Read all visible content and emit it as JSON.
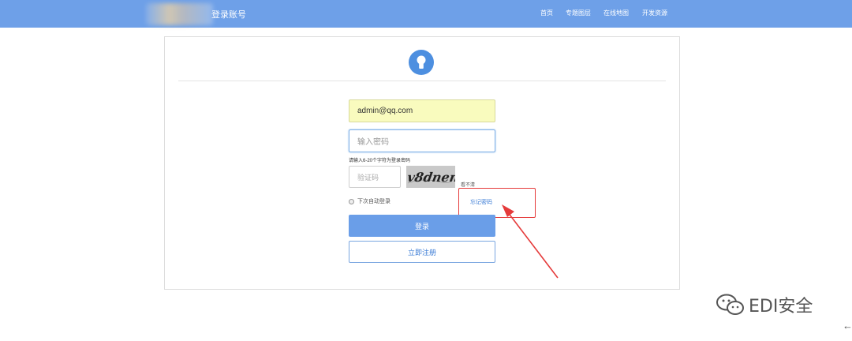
{
  "header": {
    "site_title": "登录账号",
    "nav": [
      {
        "label": "首页"
      },
      {
        "label": "专题图层"
      },
      {
        "label": "在线地图"
      },
      {
        "label": "开发资源"
      }
    ],
    "color": "#6ea0e8"
  },
  "login": {
    "email_value": "admin@qq.com",
    "password_placeholder": "输入密码",
    "password_hint": "请输入6-20个字符为登录密码",
    "captcha_placeholder": "验证码",
    "captcha_image_text": "v8dnen",
    "captcha_refresh": "看不清",
    "remember_label": "下次自动登录",
    "forgot_label": "忘记密码",
    "login_button": "登录",
    "register_button": "立即注册",
    "accent": "#4d8fe0"
  },
  "annotation": {
    "color": "#e53b3b"
  },
  "watermark": {
    "text": "EDI安全",
    "icon": "wechat-icon"
  },
  "footer": {
    "back_icon": "back-arrow-icon",
    "back_symbol": "←"
  }
}
